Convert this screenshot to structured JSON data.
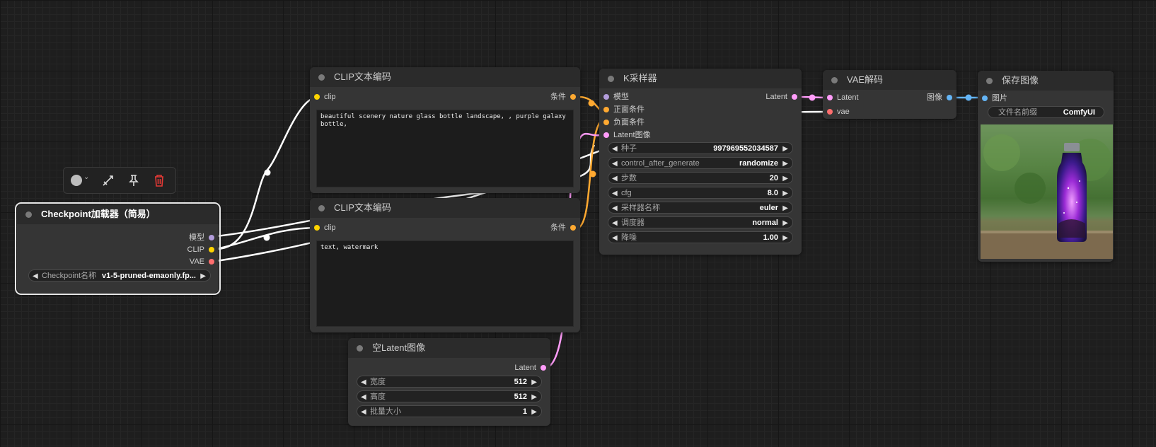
{
  "colors": {
    "background": "#1e1e1e",
    "node_body": "#353535",
    "node_title": "#2b2b2b",
    "model_slot": "#b39ddb",
    "clip_slot": "#ffd400",
    "vae_slot": "#ff6e6e",
    "conditioning_slot": "#ffa931",
    "latent_slot": "#ff9cf9",
    "image_slot": "#64b5f6",
    "delete_icon": "#e53935"
  },
  "toolbar": {
    "color_icon": "color-circle-icon",
    "chevron_icon": "chevron-down-icon",
    "bypass_icon": "bypass-icon",
    "pin_icon": "pin-icon",
    "delete_icon": "trash-icon"
  },
  "checkpoint_loader": {
    "title": "Checkpoint加载器（简易）",
    "outputs": [
      "模型",
      "CLIP",
      "VAE"
    ],
    "widget_label": "Checkpoint名称",
    "widget_value": "v1-5-pruned-emaonly.fp..."
  },
  "clip_text_positive": {
    "title": "CLIP文本编码",
    "input": "clip",
    "output": "条件",
    "text": "beautiful scenery nature glass bottle landscape, , purple galaxy bottle,"
  },
  "clip_text_negative": {
    "title": "CLIP文本编码",
    "input": "clip",
    "output": "条件",
    "text": "text, watermark"
  },
  "empty_latent": {
    "title": "空Latent图像",
    "output": "Latent",
    "widgets": [
      {
        "label": "宽度",
        "value": "512"
      },
      {
        "label": "高度",
        "value": "512"
      },
      {
        "label": "批量大小",
        "value": "1"
      }
    ]
  },
  "ksampler": {
    "title": "K采样器",
    "inputs": [
      "模型",
      "正面条件",
      "负面条件",
      "Latent图像"
    ],
    "output": "Latent",
    "widgets": [
      {
        "label": "种子",
        "value": "997969552034587"
      },
      {
        "label": "control_after_generate",
        "value": "randomize"
      },
      {
        "label": "步数",
        "value": "20"
      },
      {
        "label": "cfg",
        "value": "8.0"
      },
      {
        "label": "采样器名称",
        "value": "euler"
      },
      {
        "label": "调度器",
        "value": "normal"
      },
      {
        "label": "降噪",
        "value": "1.00"
      }
    ]
  },
  "vae_decode": {
    "title": "VAE解码",
    "inputs": [
      "Latent",
      "vae"
    ],
    "output": "图像"
  },
  "save_image": {
    "title": "保存图像",
    "input": "图片",
    "widget_label": "文件名前缀",
    "widget_value": "ComfyUI"
  }
}
